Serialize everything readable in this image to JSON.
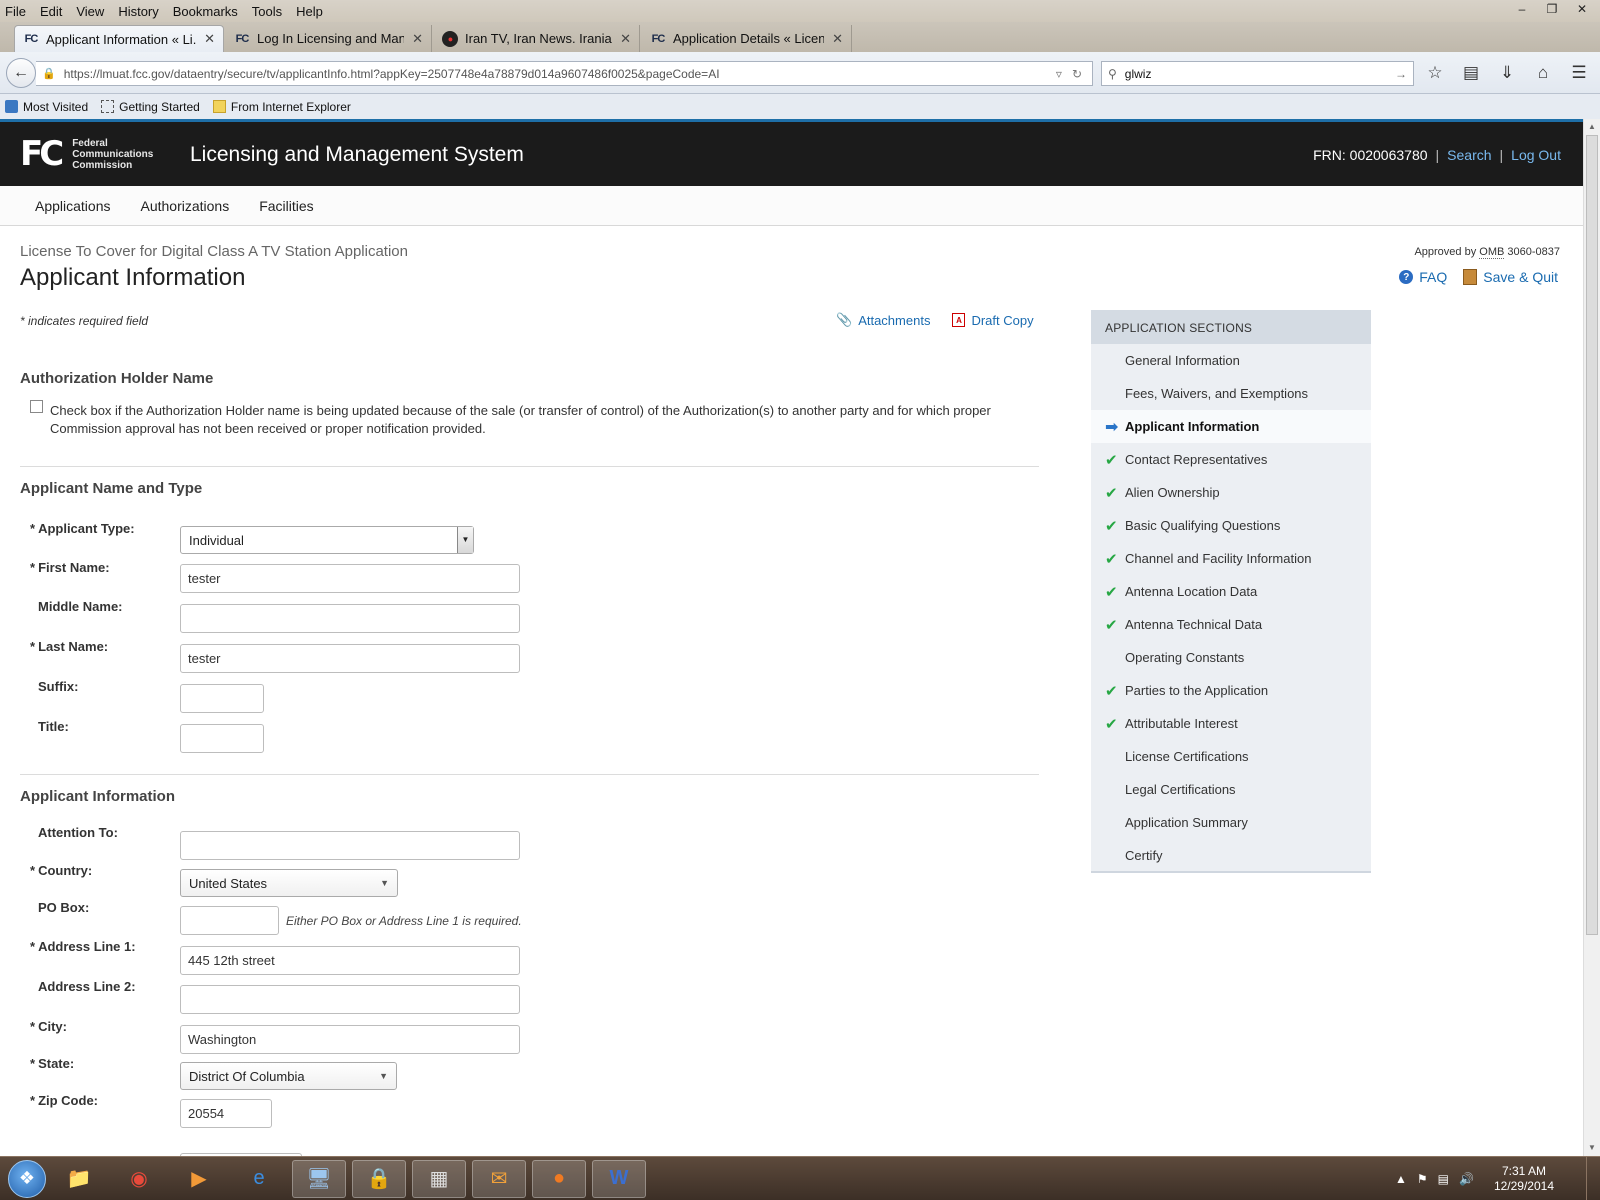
{
  "browser": {
    "menu": [
      "File",
      "Edit",
      "View",
      "History",
      "Bookmarks",
      "Tools",
      "Help"
    ],
    "tabs": [
      {
        "favicon": "FC",
        "label": "Applicant Information « Li..."
      },
      {
        "favicon": "FC",
        "label": "Log In Licensing and Mana..."
      },
      {
        "favicon": "",
        "label": "Iran TV, Iran News. Iranian ..."
      },
      {
        "favicon": "FC",
        "label": "Application Details « Licen..."
      }
    ],
    "url": "https://lmuat.fcc.gov/dataentry/secure/tv/applicantInfo.html?appKey=2507748e4a78879d014a9607486f0025&pageCode=AI",
    "search_value": "glwiz",
    "bookmarks": [
      "Most Visited",
      "Getting Started",
      "From Internet Explorer"
    ]
  },
  "header": {
    "logo_mark": "FC",
    "org_lines": [
      "Federal",
      "Communications",
      "Commission"
    ],
    "title": "Licensing and Management System",
    "frn": "FRN: 0020063780",
    "search": "Search",
    "logout": "Log Out",
    "sep": "|"
  },
  "mainnav": [
    "Applications",
    "Authorizations",
    "Facilities"
  ],
  "page": {
    "app_type": "License To Cover for Digital Class A TV Station Application",
    "title": "Applicant Information",
    "omb_prefix": "Approved by ",
    "omb_abbr": "OMB",
    "omb_num": " 3060-0837",
    "faq": "FAQ",
    "save_quit": "Save & Quit",
    "required_note": "* indicates required field",
    "attachments": "Attachments",
    "draft_copy": "Draft Copy"
  },
  "auth_holder": {
    "heading": "Authorization Holder Name",
    "checkbox_text": "Check box if the Authorization Holder name is being updated because of the sale (or transfer of control) of the Authorization(s) to another party and for which proper Commission approval has not been received or proper notification provided."
  },
  "name_type": {
    "heading": "Applicant Name and Type",
    "applicant_type": {
      "label": "Applicant Type:",
      "value": "Individual"
    },
    "first_name": {
      "label": "First Name:",
      "value": "tester"
    },
    "middle_name": {
      "label": "Middle Name:",
      "value": ""
    },
    "last_name": {
      "label": "Last Name:",
      "value": "tester"
    },
    "suffix": {
      "label": "Suffix:",
      "value": ""
    },
    "title": {
      "label": "Title:",
      "value": ""
    }
  },
  "applicant_info": {
    "heading": "Applicant Information",
    "attention_to": {
      "label": "Attention To:",
      "value": ""
    },
    "country": {
      "label": "Country:",
      "value": "United States"
    },
    "po_box": {
      "label": "PO Box:",
      "value": "",
      "hint": "Either PO Box or Address Line 1 is required."
    },
    "address1": {
      "label": "Address Line 1:",
      "value": "445 12th  street"
    },
    "address2": {
      "label": "Address Line 2:",
      "value": ""
    },
    "city": {
      "label": "City:",
      "value": "Washington"
    },
    "state": {
      "label": "State:",
      "value": "District Of Columbia"
    },
    "zip": {
      "label": "Zip Code:",
      "value": "20554"
    }
  },
  "sidebar": {
    "heading": "APPLICATION SECTIONS",
    "items": [
      {
        "label": "General Information",
        "status": "none"
      },
      {
        "label": "Fees, Waivers, and Exemptions",
        "status": "none"
      },
      {
        "label": "Applicant Information",
        "status": "current"
      },
      {
        "label": "Contact Representatives",
        "status": "complete"
      },
      {
        "label": "Alien Ownership",
        "status": "complete"
      },
      {
        "label": "Basic Qualifying Questions",
        "status": "complete"
      },
      {
        "label": "Channel and Facility Information",
        "status": "complete"
      },
      {
        "label": "Antenna Location Data",
        "status": "complete"
      },
      {
        "label": "Antenna Technical Data",
        "status": "complete"
      },
      {
        "label": "Operating Constants",
        "status": "none"
      },
      {
        "label": "Parties to the Application",
        "status": "complete"
      },
      {
        "label": "Attributable Interest",
        "status": "complete"
      },
      {
        "label": "License Certifications",
        "status": "none"
      },
      {
        "label": "Legal Certifications",
        "status": "none"
      },
      {
        "label": "Application Summary",
        "status": "none"
      },
      {
        "label": "Certify",
        "status": "none"
      }
    ]
  },
  "taskbar": {
    "time": "7:31 AM",
    "date": "12/29/2014"
  },
  "colors": {
    "link": "#1a6bb0",
    "header_bg": "#1b1b1b",
    "check_green": "#27a744",
    "sidebar_bg": "#eceff3"
  }
}
